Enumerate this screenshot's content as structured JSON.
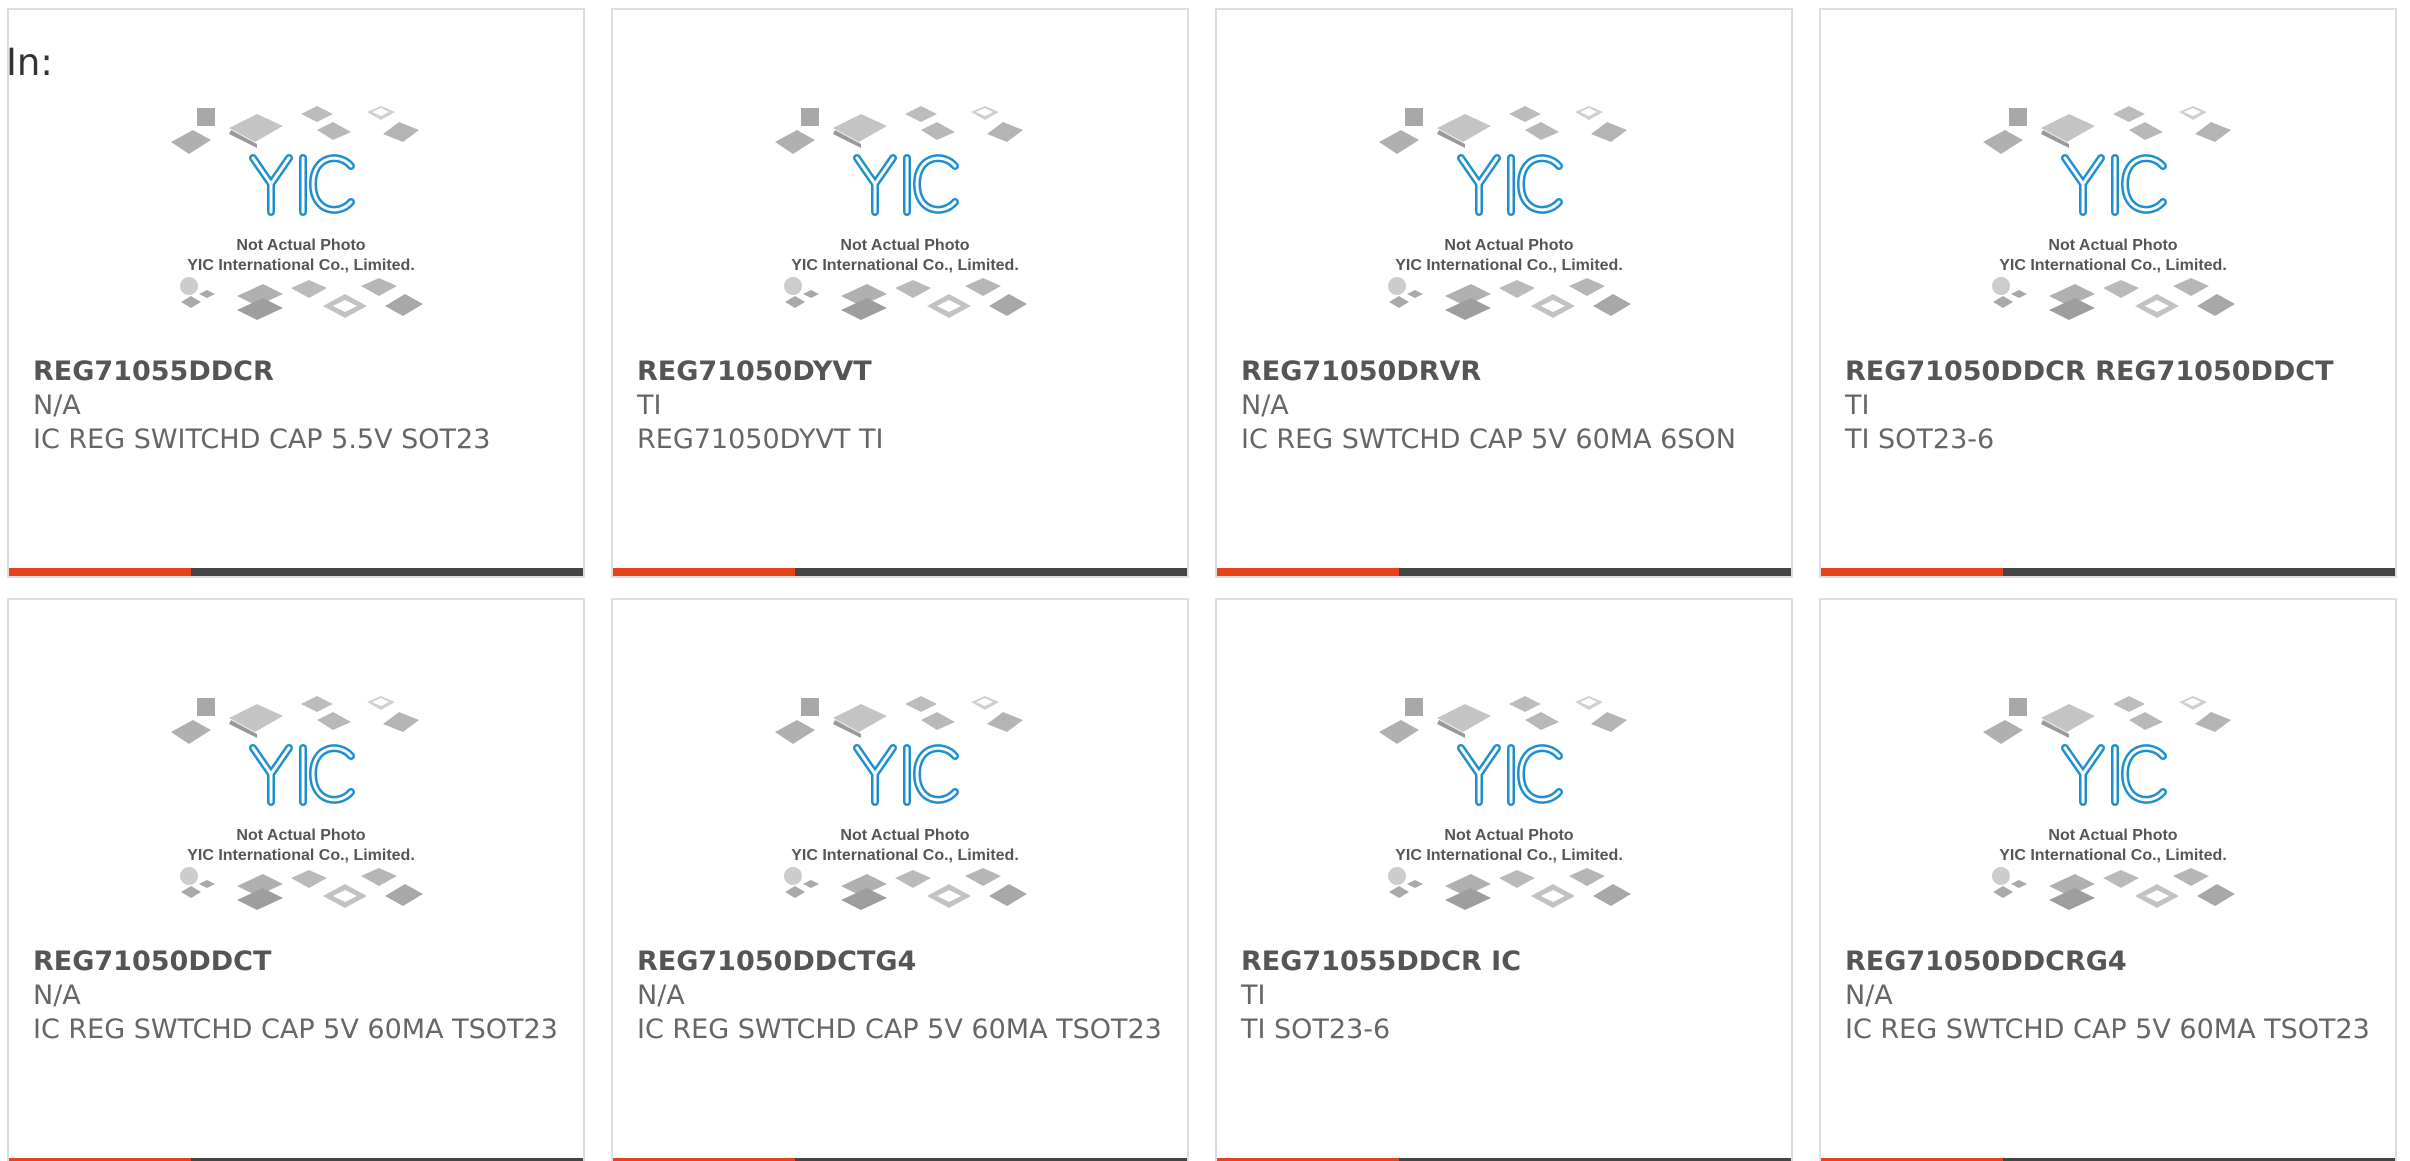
{
  "header": {
    "prefix": "In:"
  },
  "watermark": {
    "logo": "YIC",
    "line1": "Not Actual Photo",
    "line2": "YIC International Co., Limited."
  },
  "colors": {
    "accent": "#e5441b",
    "bar": "#444444",
    "logo": "#1d8fcf",
    "chips": "#b5b5b5"
  },
  "products": [
    {
      "part": "REG71055DDCR",
      "maker": "N/A",
      "desc": "IC REG SWITCHD CAP 5.5V SOT23"
    },
    {
      "part": "REG71050DYVT",
      "maker": "TI",
      "desc": "REG71050DYVT TI"
    },
    {
      "part": "REG71050DRVR",
      "maker": "N/A",
      "desc": "IC REG SWTCHD CAP 5V 60MA 6SON"
    },
    {
      "part": "REG71050DDCR REG71050DDCT",
      "maker": "TI",
      "desc": "TI SOT23-6"
    },
    {
      "part": "REG71050DDCT",
      "maker": "N/A",
      "desc": "IC REG SWTCHD CAP 5V 60MA TSOT23"
    },
    {
      "part": "REG71050DDCTG4",
      "maker": "N/A",
      "desc": "IC REG SWTCHD CAP 5V 60MA TSOT23"
    },
    {
      "part": "REG71055DDCR IC",
      "maker": "TI",
      "desc": "TI SOT23-6"
    },
    {
      "part": "REG71050DDCRG4",
      "maker": "N/A",
      "desc": "IC REG SWTCHD CAP 5V 60MA TSOT23"
    }
  ]
}
